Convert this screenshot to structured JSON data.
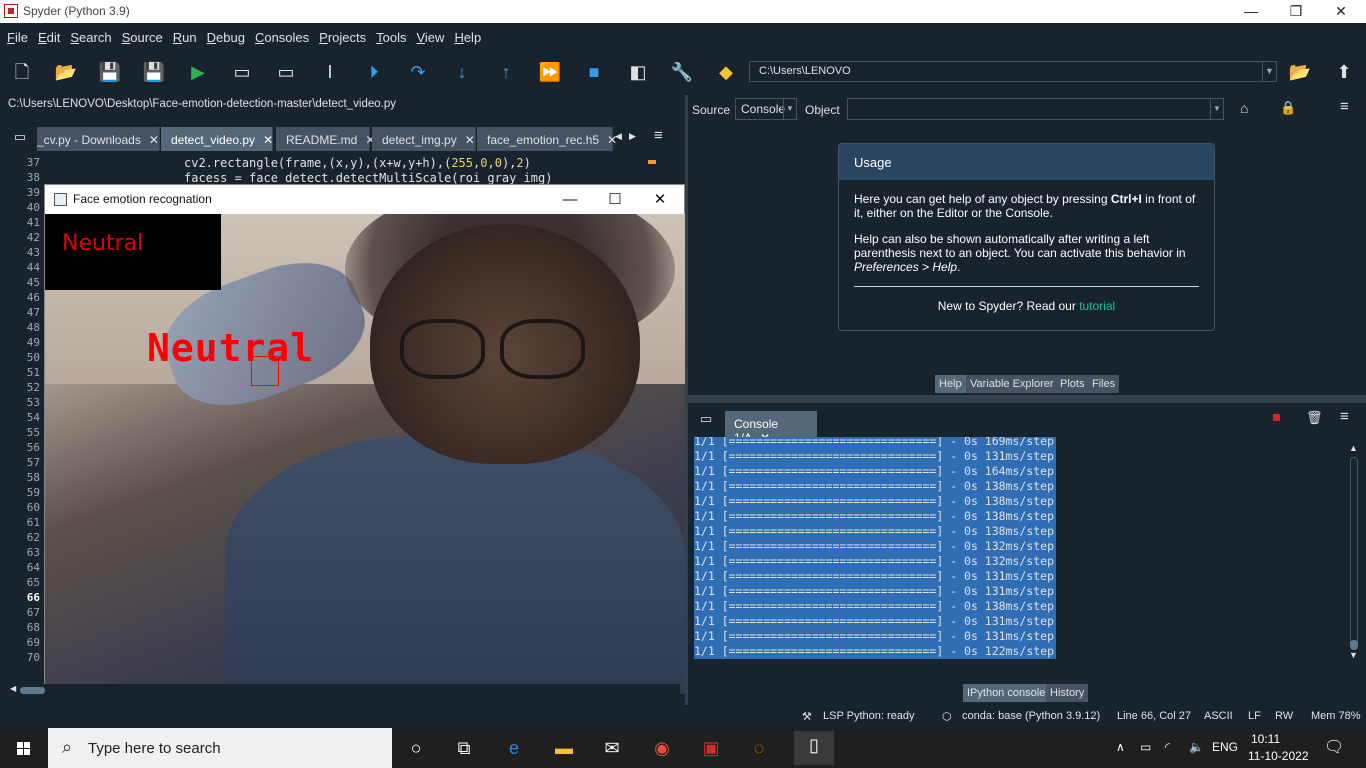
{
  "window": {
    "title": "Spyder (Python 3.9)"
  },
  "menu": [
    "File",
    "Edit",
    "Search",
    "Source",
    "Run",
    "Debug",
    "Consoles",
    "Projects",
    "Tools",
    "View",
    "Help"
  ],
  "toolbar": {
    "path": "C:\\Users\\LENOVO"
  },
  "editor": {
    "file_path": "C:\\Users\\LENOVO\\Desktop\\Face-emotion-detection-master\\detect_video.py",
    "tabs": [
      {
        "label": "_cv.py - Downloads"
      },
      {
        "label": "detect_video.py"
      },
      {
        "label": "README.md"
      },
      {
        "label": "detect_img.py"
      },
      {
        "label": "face_emotion_rec.h5"
      }
    ],
    "line_numbers": [
      "37",
      "38",
      "39",
      "40",
      "41",
      "42",
      "43",
      "44",
      "45",
      "46",
      "47",
      "48",
      "49",
      "50",
      "51",
      "52",
      "53",
      "54",
      "55",
      "56",
      "57",
      "58",
      "59",
      "60",
      "61",
      "62",
      "63",
      "64",
      "65",
      "66",
      "67",
      "68",
      "69",
      "70"
    ],
    "current_line": "66",
    "code_line_37a": "cv2.rectangle(frame,(x,y),(x+w,y+h),(",
    "code_line_37n1": "255",
    "code_line_37c1": ",",
    "code_line_37n2": "0",
    "code_line_37c2": ",",
    "code_line_37n3": "0",
    "code_line_37c3": "),",
    "code_line_37n4": "2",
    "code_line_37c4": ")",
    "code_line_38": "facess = face_detect.detectMultiScale(roi_gray_img)"
  },
  "cv_window": {
    "title": "Face emotion recognation",
    "label_top": "Neutral",
    "label_face": "Neutral"
  },
  "help": {
    "source_label": "Source",
    "source_value": "Console",
    "object_label": "Object",
    "usage_title": "Usage",
    "p1_a": "Here you can get help of any object by pressing ",
    "p1_b": "Ctrl+I",
    "p1_c": " in front of it, either on the Editor or the Console.",
    "p2_a": "Help can also be shown automatically after writing a left parenthesis next to an object. You can activate this behavior in ",
    "p2_b": "Preferences > Help",
    "p2_c": ".",
    "new_a": "New to Spyder? Read our ",
    "new_link": "tutorial"
  },
  "pane_tabs": [
    "Help",
    "Variable Explorer",
    "Plots",
    "Files"
  ],
  "console": {
    "tab": "Console 1/A",
    "lines": [
      "1/1 [==============================] - 0s 169ms/step",
      "1/1 [==============================] - 0s 131ms/step",
      "1/1 [==============================] - 0s 164ms/step",
      "1/1 [==============================] - 0s 138ms/step",
      "1/1 [==============================] - 0s 138ms/step",
      "1/1 [==============================] - 0s 138ms/step",
      "1/1 [==============================] - 0s 138ms/step",
      "1/1 [==============================] - 0s 132ms/step",
      "1/1 [==============================] - 0s 132ms/step",
      "1/1 [==============================] - 0s 131ms/step",
      "1/1 [==============================] - 0s 131ms/step",
      "1/1 [==============================] - 0s 138ms/step",
      "1/1 [==============================] - 0s 131ms/step",
      "1/1 [==============================] - 0s 131ms/step",
      "1/1 [==============================] - 0s 122ms/step"
    ]
  },
  "bottom_tabs": [
    "IPython console",
    "History"
  ],
  "status": {
    "lsp": "LSP Python: ready",
    "conda": "conda: base (Python 3.9.12)",
    "position": "Line 66, Col 27",
    "encoding": "ASCII",
    "eol": "LF",
    "mode": "RW",
    "mem": "Mem 78%"
  },
  "taskbar": {
    "search_placeholder": "Type here to search",
    "lang": "ENG",
    "time": "10:11",
    "date": "11-10-2022"
  }
}
